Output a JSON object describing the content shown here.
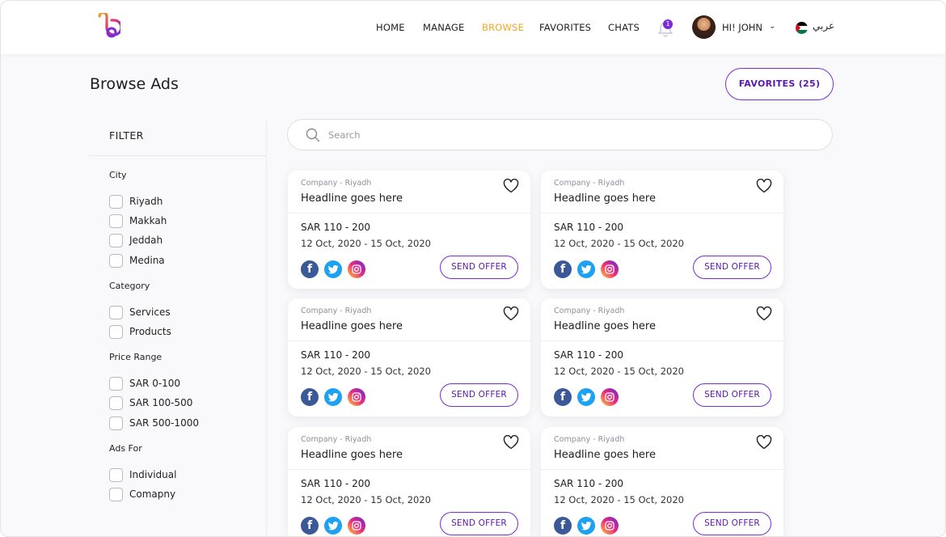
{
  "header": {
    "nav": [
      {
        "label": "HOME",
        "active": false
      },
      {
        "label": "MANAGE",
        "active": false
      },
      {
        "label": "BROWSE",
        "active": true
      },
      {
        "label": "FAVORITES",
        "active": false
      },
      {
        "label": "CHATS",
        "active": false
      }
    ],
    "notification_count": "1",
    "greeting": "HI! JOHN",
    "language": "عربي"
  },
  "page": {
    "title": "Browse Ads",
    "favorites_button": "FAVORITES (25)"
  },
  "filter": {
    "title": "FILTER",
    "groups": [
      {
        "title": "City",
        "options": [
          "Riyadh",
          "Makkah",
          "Jeddah",
          "Medina"
        ]
      },
      {
        "title": "Category",
        "options": [
          "Services",
          "Products"
        ]
      },
      {
        "title": "Price Range",
        "options": [
          "SAR 0-100",
          "SAR 100-500",
          "SAR 500-1000"
        ]
      },
      {
        "title": "Ads For",
        "options": [
          "Individual",
          "Comapny"
        ]
      }
    ]
  },
  "search": {
    "placeholder": "Search"
  },
  "ads": [
    {
      "company": "Company - Riyadh",
      "headline": "Headline goes here",
      "price": "SAR 110 - 200",
      "dates": "12 Oct, 2020 - 15 Oct, 2020",
      "offer_label": "SEND OFFER"
    },
    {
      "company": "Company - Riyadh",
      "headline": "Headline goes here",
      "price": "SAR 110 - 200",
      "dates": "12 Oct, 2020 - 15 Oct, 2020",
      "offer_label": "SEND OFFER"
    },
    {
      "company": "Company - Riyadh",
      "headline": "Headline goes here",
      "price": "SAR 110 - 200",
      "dates": "12 Oct, 2020 - 15 Oct, 2020",
      "offer_label": "SEND OFFER"
    },
    {
      "company": "Company - Riyadh",
      "headline": "Headline goes here",
      "price": "SAR 110 - 200",
      "dates": "12 Oct, 2020 - 15 Oct, 2020",
      "offer_label": "SEND OFFER"
    },
    {
      "company": "Company - Riyadh",
      "headline": "Headline goes here",
      "price": "SAR 110 - 200",
      "dates": "12 Oct, 2020 - 15 Oct, 2020",
      "offer_label": "SEND OFFER"
    },
    {
      "company": "Company - Riyadh",
      "headline": "Headline goes here",
      "price": "SAR 110 - 200",
      "dates": "12 Oct, 2020 - 15 Oct, 2020",
      "offer_label": "SEND OFFER"
    }
  ],
  "colors": {
    "accent": "#7b2bd8",
    "active_nav": "#f5a623",
    "facebook": "#3b5998",
    "twitter": "#1da1f2"
  },
  "icons": [
    "app-logo-icon",
    "bell-icon",
    "chevron-down-icon",
    "flag-icon",
    "search-icon",
    "heart-icon",
    "facebook-icon",
    "twitter-icon",
    "instagram-icon"
  ]
}
